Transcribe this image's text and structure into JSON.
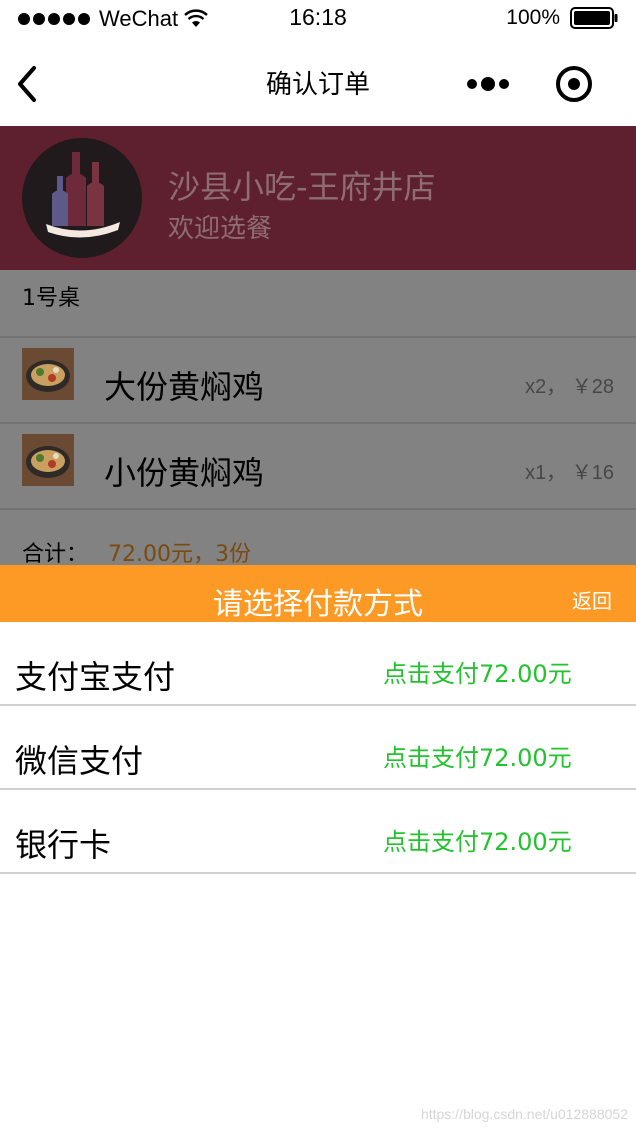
{
  "status_bar": {
    "carrier": "WeChat",
    "time": "16:18",
    "battery": "100%"
  },
  "nav": {
    "title": "确认订单",
    "icons": [
      "back-icon",
      "more-icon",
      "close-capsule-icon"
    ]
  },
  "shop": {
    "name": "沙县小吃-王府井店",
    "subtitle": "欢迎选餐"
  },
  "order": {
    "table": "1号桌",
    "items": [
      {
        "name": "大份黄焖鸡",
        "qty_price": "x2， ￥28"
      },
      {
        "name": "小份黄焖鸡",
        "qty_price": "x1， ￥16"
      }
    ],
    "total_label": "合计：",
    "total_value": "72.00元，3份"
  },
  "payment_sheet": {
    "title": "请选择付款方式",
    "back_label": "返回",
    "methods": [
      {
        "name": "支付宝支付",
        "action": "点击支付72.00元"
      },
      {
        "name": "微信支付",
        "action": "点击支付72.00元"
      },
      {
        "name": "银行卡",
        "action": "点击支付72.00元"
      }
    ]
  },
  "watermark": "https://blog.csdn.net/u012888052",
  "colors": {
    "banner": "#5e1f2e",
    "sheet_header": "#fd9a26",
    "pay_action": "#22c32e",
    "overlay_gray": "#828282"
  }
}
